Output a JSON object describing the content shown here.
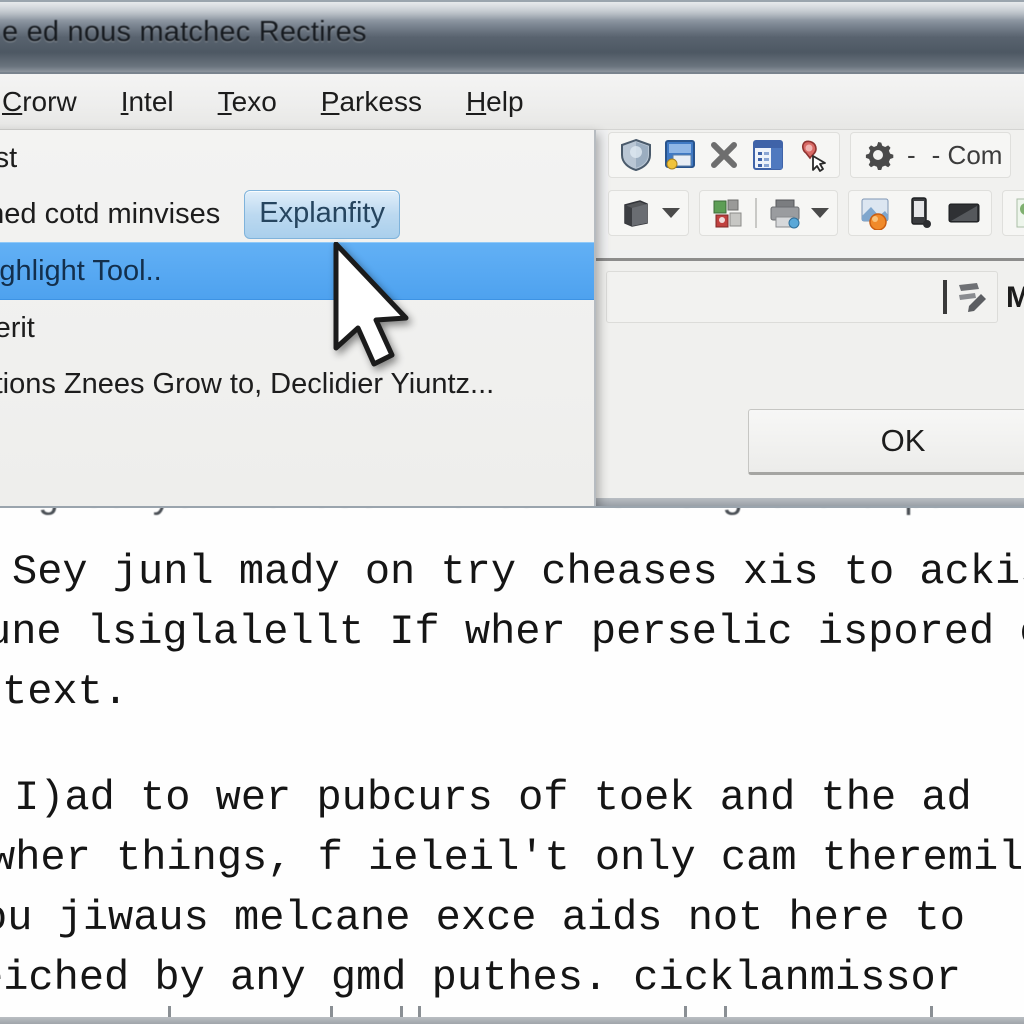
{
  "window": {
    "title": "e ed nous matchec Rectires"
  },
  "menubar": {
    "items": [
      {
        "pre": "",
        "accel": "C",
        "post": "rorw",
        "name": "menu-crorw"
      },
      {
        "pre": "",
        "accel": "I",
        "post": "ntel",
        "name": "menu-intel"
      },
      {
        "pre": "",
        "accel": "T",
        "post": "exo",
        "name": "menu-texo"
      },
      {
        "pre": "",
        "accel": "P",
        "post": "arkess",
        "name": "menu-parkess"
      },
      {
        "pre": "",
        "accel": "H",
        "post": "elp",
        "name": "menu-help"
      }
    ]
  },
  "dropdown": {
    "items": [
      {
        "label": "iest",
        "highlighted": false,
        "has_button": false
      },
      {
        "label": "ohed cotd minvises",
        "highlighted": false,
        "has_button": true,
        "button_label": "Explanfity"
      },
      {
        "label": "Highlight Tool..",
        "highlighted": true,
        "has_button": false
      },
      {
        "label": "nierit",
        "highlighted": false,
        "has_button": false
      },
      {
        "label": "aitions Znees Grow to, Declidier Yiuntz...",
        "highlighted": false,
        "has_button": false
      }
    ]
  },
  "toolbar": {
    "row1_icons": [
      "shield-icon",
      "window-restore-icon",
      "close-x-icon",
      "list-panel-icon",
      "pin-pointer-icon"
    ],
    "row1_options_label": "- Com",
    "row1_gear_icon": "gear-icon",
    "row2_icons": [
      "server-box-icon",
      "contacts-icon",
      "printer-icon",
      "palette-icon",
      "mobile-device-icon",
      "widescreen-icon",
      "photo-icon"
    ],
    "dropdown_caret": "chevron-down-icon"
  },
  "panel": {
    "field_value": "",
    "field_icon": "edit-note-icon",
    "side_label": "M",
    "ok_label": "OK"
  },
  "document": {
    "clipped_top_line": "rg seryer la:est who to insrrsignencnd pu",
    "paragraph1": [
      "Sey junl mady on try cheases xis to ackis",
      "une lsiglalellt If wher perselic ispored cil",
      "text."
    ],
    "paragraph2": [
      "I)ad to wer pubcurs of toek and the ad",
      "wher things, f ieleil't only cam theremil",
      "ou jiwaus melcane exce aids not here to",
      "eiched by any gmd puthes. cicklanmissor"
    ]
  },
  "colors": {
    "highlight_blue": "#4ea2ef",
    "titlebar_dark": "#59636f",
    "chrome_gray": "#eff0f1"
  }
}
